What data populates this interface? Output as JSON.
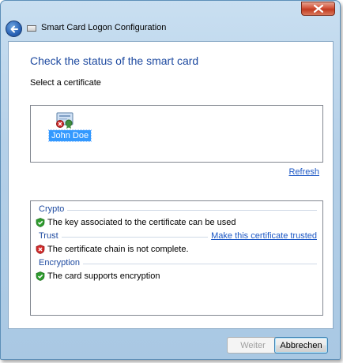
{
  "window": {
    "title": "Smart Card Logon Configuration"
  },
  "page": {
    "heading": "Check the status of the smart card",
    "select_label": "Select a certificate"
  },
  "certificates": [
    {
      "name": "John Doe",
      "selected": true,
      "icon": "certificate-error-icon"
    }
  ],
  "refresh_label": "Refresh",
  "status": {
    "crypto": {
      "header": "Crypto",
      "message": "The key associated to the certificate can be used",
      "icon": "check-shield-icon"
    },
    "trust": {
      "header": "Trust",
      "link": "Make this certificate trusted",
      "message": "The certificate chain is not complete.",
      "icon": "error-shield-icon"
    },
    "encryption": {
      "header": "Encryption",
      "message": "The card supports encryption",
      "icon": "check-shield-icon"
    }
  },
  "buttons": {
    "next": "Weiter",
    "cancel": "Abbrechen"
  },
  "colors": {
    "accent_heading": "#1e4aa0",
    "link": "#1a56c4",
    "selection": "#3399ff",
    "ok_green": "#2e9b2e",
    "error_red": "#d22b2b"
  }
}
